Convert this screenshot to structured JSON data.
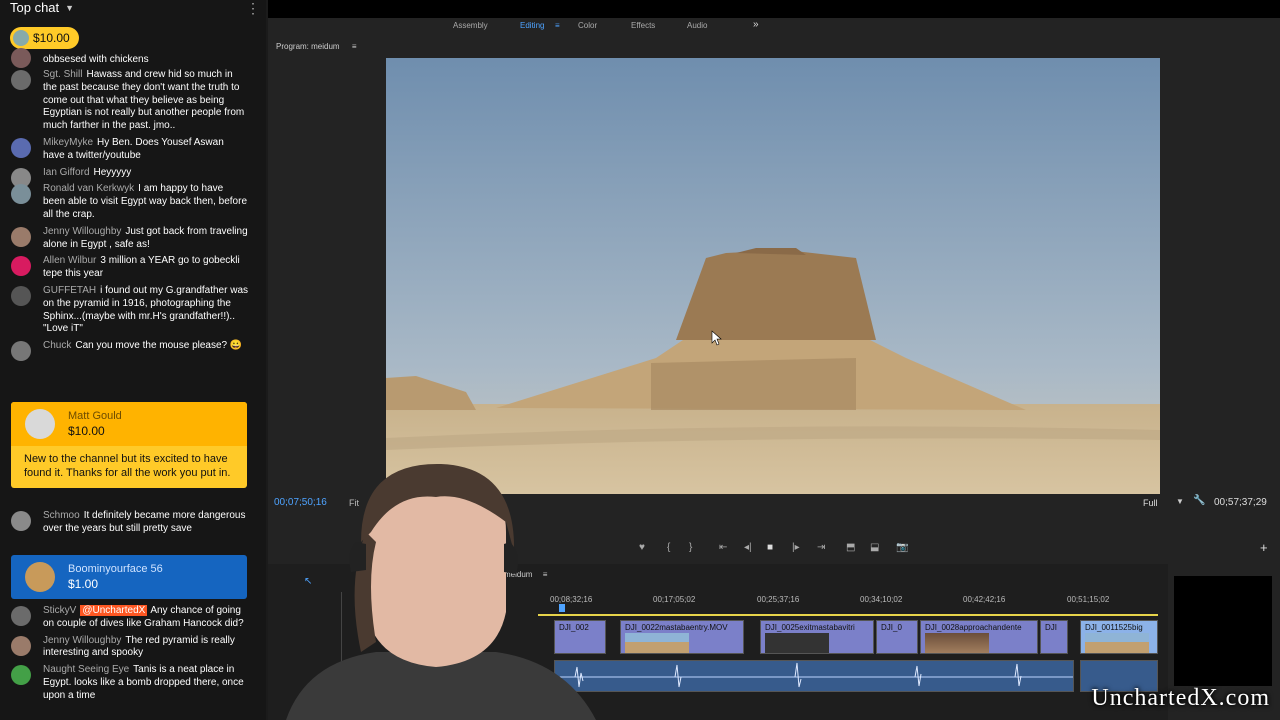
{
  "chat": {
    "header_label": "Top chat",
    "ticker_amount": "$10.00",
    "partial_message": "obbsesed with chickens",
    "messages": [
      {
        "author": "Sgt. Shill",
        "text": "Hawass and crew hid so much in the past because they don't want the truth to come out that what they believe as being Egyptian is not really but another people from much farther in the past. jmo..",
        "avatar_color": "#6b6b6b"
      },
      {
        "author": "MikeyMyke",
        "text": "Hy Ben. Does Yousef Aswan have a twitter/youtube",
        "avatar_color": "#5a6bb0"
      },
      {
        "author": "Ian Gifford",
        "text": "Heyyyyy",
        "avatar_color": "#888888"
      },
      {
        "author": "Ronald van Kerkwyk",
        "text": "I am happy to have been able to visit Egypt way back then, before all the crap.",
        "avatar_color": "#7a8f99"
      },
      {
        "author": "Jenny Willoughby",
        "text": "Just got back from traveling alone in Egypt , safe as!",
        "avatar_color": "#9a7b6a"
      },
      {
        "author": "Allen Wilbur",
        "text": "3 million a YEAR go to gobeckli tepe this year",
        "avatar_color": "#d81b60"
      },
      {
        "author": "GUFFETAH",
        "text": "i found out my G.grandfather was on the pyramid in 1916, photographing the Sphinx...(maybe with mr.H's grandfather!!).. \"Love iT\"",
        "avatar_color": "#555555"
      },
      {
        "author": "Chuck",
        "text": "Can you move the mouse please? 😀",
        "avatar_color": "#777777"
      }
    ],
    "superchat_1": {
      "name": "Matt Gould",
      "amount": "$10.00",
      "message": "New to the channel but its excited to have found it. Thanks for all the work you put in.",
      "color": "#ffca28"
    },
    "messages_2": [
      {
        "author": "Schmoo",
        "text": "It definitely became more dangerous over the years but still pretty save",
        "avatar_color": "#8a8a8a"
      }
    ],
    "superchat_2": {
      "name": "Boominyourface 56",
      "amount": "$1.00",
      "color": "#1565c0"
    },
    "messages_3": [
      {
        "author": "StickyV",
        "mention": "@UnchartedX",
        "text": "Any chance of going on couple of dives like Graham Hancock did?",
        "avatar_color": "#6b6b6b"
      },
      {
        "author": "Jenny Willoughby",
        "text": "The red pyramid is really interesting and spooky",
        "avatar_color": "#9a7b6a"
      },
      {
        "author": "Naught Seeing Eye",
        "text": "Tanis is a neat place in Egypt. looks like a bomb dropped there, once upon a time",
        "avatar_color": "#43a047"
      }
    ]
  },
  "editor": {
    "workspaces": [
      "Assembly",
      "Editing",
      "Color",
      "Effects",
      "Audio"
    ],
    "active_workspace": "Editing",
    "program_title": "Program: meidum",
    "current_timecode": "00;07;50;16",
    "fit_label": "Fit",
    "quality_label": "Full",
    "duration_timecode": "00;57;37;29",
    "sequence_tab": "meidum",
    "ruler_labels": [
      "00;08;32;16",
      "00;17;05;02",
      "00;25;37;16",
      "00;34;10;02",
      "00;42;42;16",
      "00;51;15;02"
    ],
    "clips": [
      "DJI_002",
      "DJI_0022mastabaentry.MOV",
      "DJI_0025exitmastabavitri",
      "DJI_0",
      "DJI_0028approachandente",
      "DJI",
      "DJI_0011525big"
    ]
  },
  "watermark": "UnchartedX.com"
}
